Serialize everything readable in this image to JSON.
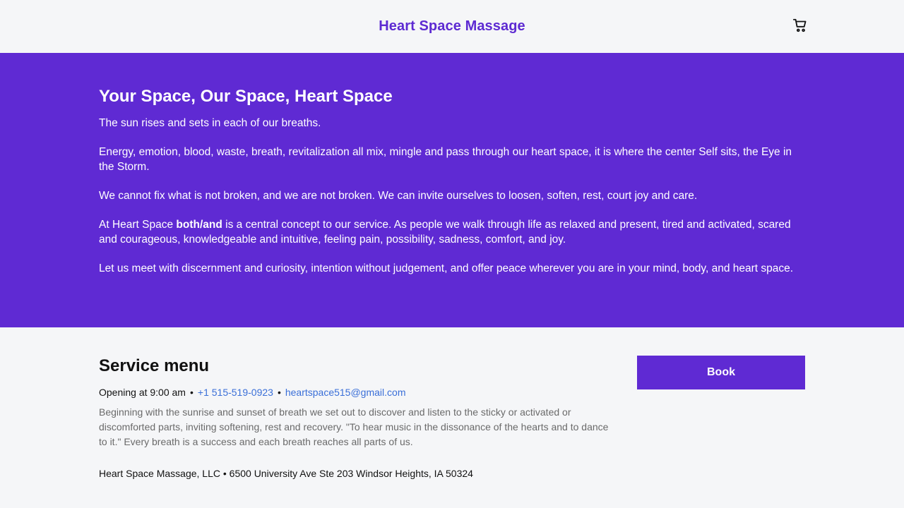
{
  "header": {
    "title": "Heart Space Massage",
    "cart_icon": "shopping-cart-icon"
  },
  "hero": {
    "heading": "Your Space, Our Space, Heart Space",
    "paragraphs": [
      "The sun rises and sets in each of our breaths.",
      "Energy, emotion, blood, waste, breath, revitalization all mix, mingle and pass through our heart space, it is where the center Self sits, the Eye in the Storm.",
      "We cannot fix what is not broken, and we are not broken. We can invite ourselves to loosen, soften, rest, court joy and care."
    ],
    "both_and": {
      "before": "At Heart Space ",
      "bold": "both/and",
      "after": " is a central concept to our service. As people we walk through life as relaxed and present, tired and activated, scared and courageous, knowledgeable and intuitive, feeling pain, possibility, sadness, comfort, and joy."
    },
    "closing": "Let us meet with discernment and curiosity, intention without judgement, and offer peace wherever you are in your mind, body, and heart space.",
    "background_color": "#5f2ad3"
  },
  "service": {
    "heading": "Service menu",
    "opening": "Opening at 9:00 am",
    "separator": "•",
    "phone": "+1 515-519-0923",
    "email": "heartspace515@gmail.com",
    "description": "Beginning with the sunrise and sunset of breath we set out to discover and listen to the sticky or activated or discomforted parts, inviting softening, rest and recovery. \"To hear music in the dissonance of the hearts and to dance to it.\" Every breath is a success and each breath reaches all parts of us.",
    "address": "Heart Space Massage, LLC • 6500 University Ave Ste 203 Windsor Heights, IA 50324",
    "book_label": "Book"
  },
  "colors": {
    "brand": "#5d2ad2",
    "link": "#3a6fd8",
    "page_background": "#f5f6f8"
  }
}
